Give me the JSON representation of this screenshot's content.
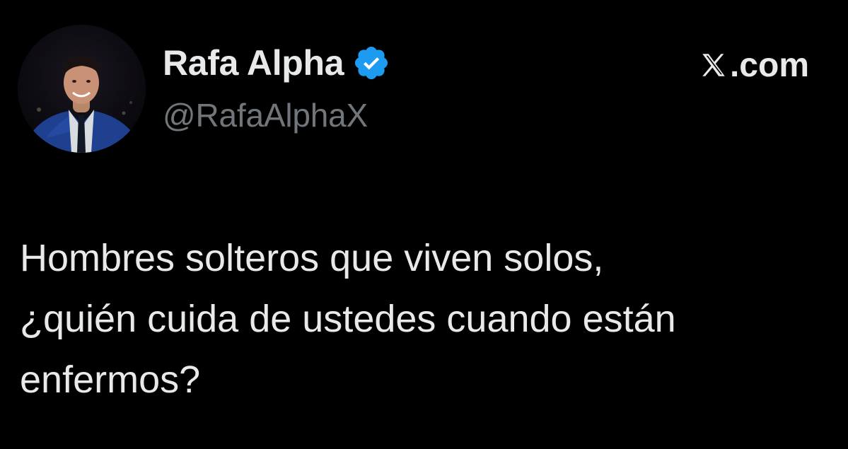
{
  "author": {
    "name": "Rafa Alpha",
    "handle": "@RafaAlphaX",
    "verified": true,
    "avatar_icon": "profile-photo"
  },
  "brand": {
    "icon": "x-logo-icon",
    "text": ".com"
  },
  "tweet": {
    "lines": [
      "Hombres solteros que viven solos,",
      "¿quién cuida de ustedes cuando están",
      "enfermos?"
    ]
  },
  "colors": {
    "background": "#000000",
    "text_primary": "#e7e9ea",
    "text_secondary": "#71767b",
    "verified_blue": "#1d9bf0"
  }
}
